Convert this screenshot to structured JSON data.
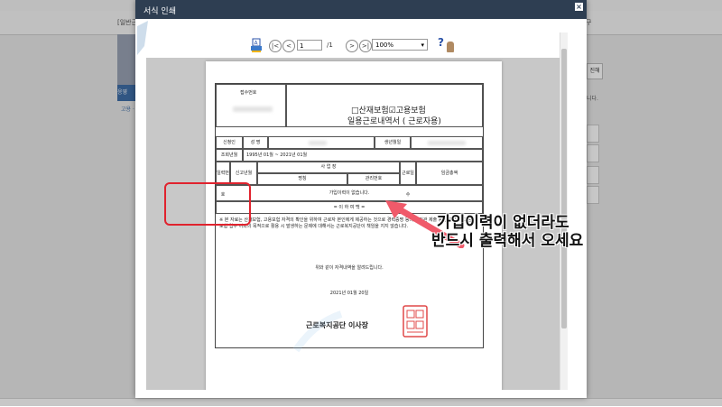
{
  "background": {
    "header_left": "[일반근",
    "header_right": "구",
    "left_blue": "응영",
    "left_link": "고용 ·",
    "right_btn": "진해",
    "right_text": "니다."
  },
  "dialog": {
    "title": "서식 인쇄",
    "close": "×"
  },
  "toolbar": {
    "page_current": "1",
    "page_total": "/1",
    "zoom": "100%",
    "zoom_arrow": "▾",
    "help": "?",
    "nav_first": "|<",
    "nav_prev": "<",
    "nav_next": ">",
    "nav_last": ">|"
  },
  "document": {
    "receipt_no_label": "접수번호",
    "title_insurance": "□산재보험☑고용보험",
    "title_main": "일용근로내역서 ( 근로자용)",
    "applicant_label": "신청인",
    "name_label": "성 명",
    "birth_label": "생년월일",
    "period_label": "조회년월",
    "period_value": "1995년 01월 ~ 2021년 01월",
    "work_label": "일력번호",
    "report_label": "신고년월",
    "workplace_label": "사 업 장",
    "workplace_name": "명칭",
    "workplace_mgmt": "관리번호",
    "days_label": "근로일수",
    "wage_label": "임금총액",
    "no_history": "가입이력이 없습니다.",
    "end_text": "= 이 하 여 백 =",
    "note": "※ 본 자료는 산재보험, 고용보험 자격의 확인을 위하여 근로자 본인에게 제공하는 것으로 경력증명 등의 타기관 제출 등 산재보험, 고용보험 업무 이외의 목적으로 활용 시 발생하는 문제에 대해서는 근로복지공단이 책임을 지지 않습니다.",
    "certify": "위와 같이 자격내역을 알려드립니다.",
    "date": "2021년 01월 20일",
    "issuer": "근로복지공단 이사장"
  },
  "annotation": {
    "line1": "가입이력이 없더라도",
    "line2": "반드시 출력해서 오세요"
  }
}
